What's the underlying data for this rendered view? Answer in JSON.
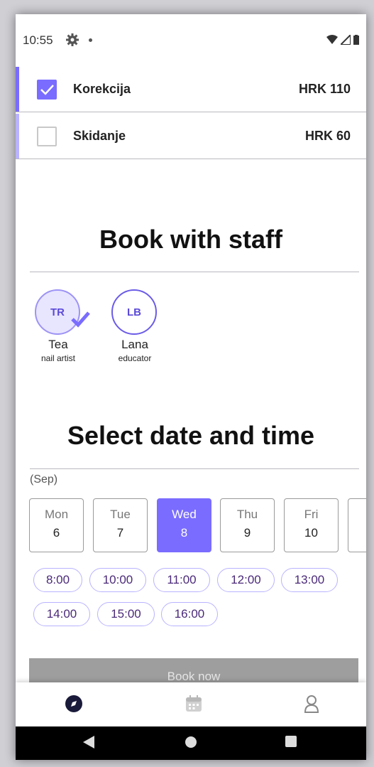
{
  "status_bar": {
    "time": "10:55"
  },
  "services": [
    {
      "name": "Korekcija",
      "price": "HRK 110",
      "checked": true
    },
    {
      "name": "Skidanje",
      "price": "HRK 60",
      "checked": false
    }
  ],
  "staff_section": {
    "title": "Book with staff",
    "members": [
      {
        "initials": "TR",
        "name": "Tea",
        "role": "nail artist",
        "selected": true
      },
      {
        "initials": "LB",
        "name": "Lana",
        "role": "educator",
        "selected": false
      }
    ]
  },
  "date_section": {
    "title": "Select date and time",
    "month": "(Sep)",
    "days": [
      {
        "name": "Mon",
        "num": "6"
      },
      {
        "name": "Tue",
        "num": "7"
      },
      {
        "name": "Wed",
        "num": "8",
        "active": true
      },
      {
        "name": "Thu",
        "num": "9"
      },
      {
        "name": "Fri",
        "num": "10"
      }
    ],
    "slots_row1": [
      "8:00",
      "10:00",
      "11:00",
      "12:00",
      "13:00"
    ],
    "slots_row2": [
      "14:00",
      "15:00",
      "16:00"
    ]
  },
  "book_button": "Book now",
  "colors": {
    "accent": "#7a6cff",
    "accent_light": "#b9b3ff",
    "slot_text": "#4b2a79"
  },
  "nav": {
    "icons": [
      "compass-icon",
      "calendar-icon",
      "profile-icon"
    ]
  }
}
